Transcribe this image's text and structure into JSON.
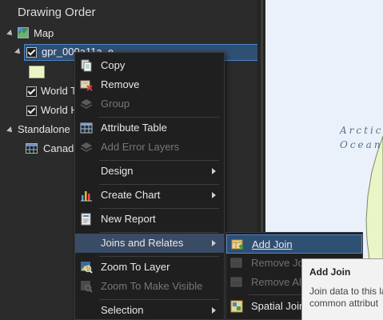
{
  "pane": {
    "title": "Drawing Order",
    "map_label": "Map",
    "layer_label": "gpr_000a11a_e",
    "world1_label": "World T",
    "world2_label": "World H",
    "standalone_label": "Standalone",
    "table_label": "Canada"
  },
  "map": {
    "ocean_line1": "Arctic",
    "ocean_line2": "Ocean",
    "land_color": "#e9f5c7",
    "water_color": "#eaf1fb"
  },
  "menu": {
    "items": [
      {
        "label": "Copy",
        "icon": "copy-icon",
        "enabled": true
      },
      {
        "label": "Remove",
        "icon": "remove-icon",
        "enabled": true
      },
      {
        "label": "Group",
        "icon": "group-icon",
        "enabled": false
      },
      {
        "label": "Attribute Table",
        "icon": "table-icon",
        "enabled": true
      },
      {
        "label": "Add Error Layers",
        "icon": "error-layers-icon",
        "enabled": false
      },
      {
        "label": "Design",
        "enabled": true,
        "submenu": true
      },
      {
        "label": "Create Chart",
        "icon": "chart-icon",
        "enabled": true,
        "submenu": true
      },
      {
        "label": "New Report",
        "icon": "report-icon",
        "enabled": true
      },
      {
        "label": "Joins and Relates",
        "enabled": true,
        "submenu": true,
        "highlighted": true
      },
      {
        "label": "Zoom To Layer",
        "icon": "zoom-layer-icon",
        "enabled": true
      },
      {
        "label": "Zoom To Make Visible",
        "icon": "zoom-visible-icon",
        "enabled": false
      },
      {
        "label": "Selection",
        "enabled": true,
        "submenu": true
      }
    ]
  },
  "submenu": {
    "items": [
      {
        "label": "Add Join",
        "icon": "add-join-icon",
        "enabled": true,
        "highlighted": true
      },
      {
        "label": "Remove Join",
        "icon": "remove-join-icon",
        "enabled": false
      },
      {
        "label": "Remove All",
        "icon": "remove-all-icon",
        "enabled": false
      },
      {
        "label": "Spatial Join",
        "icon": "spatial-join-icon",
        "enabled": true
      }
    ]
  },
  "tooltip": {
    "title": "Add Join",
    "line1": "Join data to this la",
    "line2": "common attribut"
  }
}
